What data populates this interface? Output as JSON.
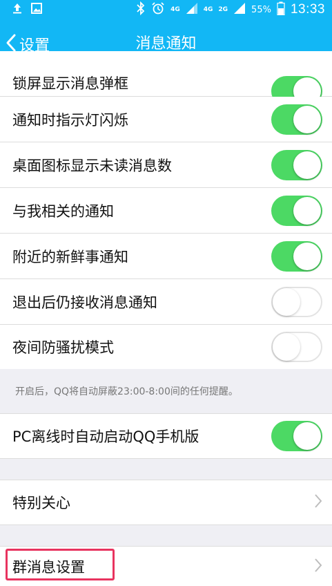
{
  "status_bar": {
    "net_4g_label": "4G",
    "net_4g_small": "4G",
    "net_2g_small": "2G",
    "battery_pct": "55%",
    "time": "13:33"
  },
  "header": {
    "back_label": "设置",
    "title": "消息通知"
  },
  "rows": [
    {
      "label": "锁屏显示消息弹框",
      "toggle": "on"
    },
    {
      "label": "通知时指示灯闪烁",
      "toggle": "on"
    },
    {
      "label": "桌面图标显示未读消息数",
      "toggle": "on"
    },
    {
      "label": "与我相关的通知",
      "toggle": "on"
    },
    {
      "label": "附近的新鲜事通知",
      "toggle": "on"
    },
    {
      "label": "退出后仍接收消息通知",
      "toggle": "off"
    },
    {
      "label": "夜间防骚扰模式",
      "toggle": "off"
    }
  ],
  "note": "开启后，QQ将自动屏蔽23:00-8:00间的任何提醒。",
  "pc_row": {
    "label": "PC离线时自动启动QQ手机版",
    "toggle": "on"
  },
  "special_row": {
    "label": "特别关心"
  },
  "group_row": {
    "label": "群消息设置"
  },
  "colors": {
    "header_bg": "#12b7f5",
    "toggle_on": "#4cd964",
    "highlight": "#e8335f"
  },
  "icons": [
    "upload-icon",
    "image-icon",
    "bluetooth-icon",
    "alarm-icon",
    "signal-icon",
    "battery-icon",
    "back-chevron-icon",
    "chevron-right-icon"
  ]
}
